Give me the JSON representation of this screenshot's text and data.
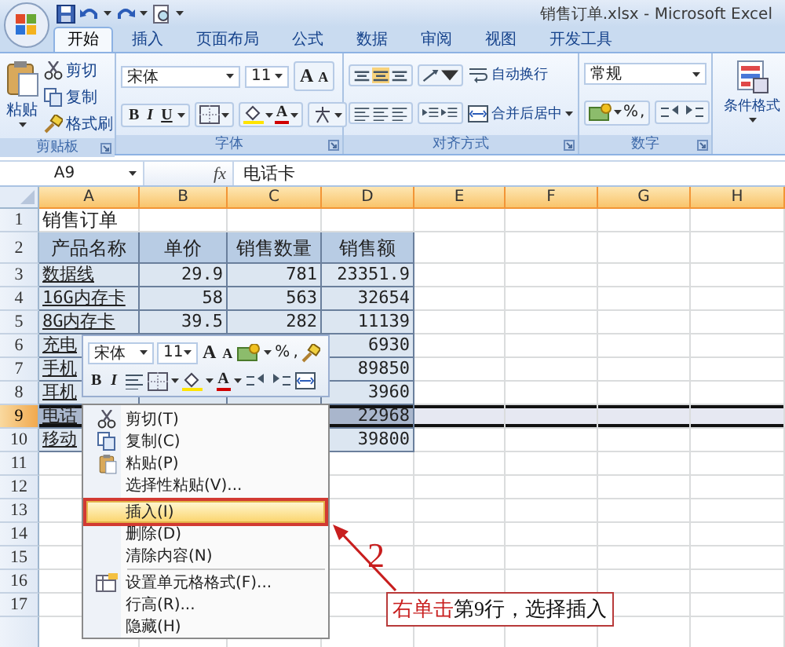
{
  "window": {
    "title": "销售订单.xlsx - Microsoft Excel"
  },
  "tabs": [
    {
      "label": "开始",
      "selected": true
    },
    {
      "label": "插入",
      "selected": false
    },
    {
      "label": "页面布局",
      "selected": false
    },
    {
      "label": "公式",
      "selected": false
    },
    {
      "label": "数据",
      "selected": false
    },
    {
      "label": "审阅",
      "selected": false
    },
    {
      "label": "视图",
      "selected": false
    },
    {
      "label": "开发工具",
      "selected": false
    }
  ],
  "ribbon": {
    "clipboard": {
      "label": "剪贴板",
      "paste": "粘贴",
      "cut": "剪切",
      "copy": "复制",
      "painter": "格式刷"
    },
    "font": {
      "label": "字体",
      "face": "宋体",
      "size": "11",
      "grow": "A",
      "shrink": "A",
      "bold": "B",
      "italic": "I",
      "underline": "U",
      "color_button": "A"
    },
    "alignment": {
      "label": "对齐方式",
      "wrap": "自动换行",
      "merge": "合并后居中"
    },
    "number": {
      "label": "数字",
      "format": "常规",
      "percent": "%",
      "comma": ","
    },
    "styles": {
      "conditional": "条件格式"
    }
  },
  "formula_bar": {
    "name_box": "A9",
    "function_label": "fx",
    "value": "电话卡"
  },
  "sheet": {
    "columns": [
      "A",
      "B",
      "C",
      "D",
      "E",
      "F",
      "G",
      "H"
    ],
    "rows": [
      {
        "number": "1",
        "selected": false,
        "cells": [
          {
            "kind": "title",
            "text": "销售订单"
          }
        ]
      },
      {
        "number": "2",
        "selected": false,
        "cells": [
          {
            "kind": "header",
            "text": "产品名称"
          },
          {
            "kind": "header",
            "text": "单价"
          },
          {
            "kind": "header",
            "text": "销售数量"
          },
          {
            "kind": "header",
            "text": "销售额"
          }
        ]
      },
      {
        "number": "3",
        "selected": false,
        "cells": [
          {
            "kind": "text",
            "text": "数据线"
          },
          {
            "kind": "number",
            "text": "29.9"
          },
          {
            "kind": "number",
            "text": "781"
          },
          {
            "kind": "number",
            "text": "23351.9"
          }
        ]
      },
      {
        "number": "4",
        "selected": false,
        "cells": [
          {
            "kind": "text",
            "text": "16G内存卡"
          },
          {
            "kind": "number",
            "text": "58"
          },
          {
            "kind": "number",
            "text": "563"
          },
          {
            "kind": "number",
            "text": "32654"
          }
        ]
      },
      {
        "number": "5",
        "selected": false,
        "cells": [
          {
            "kind": "text",
            "text": "8G内存卡"
          },
          {
            "kind": "number",
            "text": "39.5"
          },
          {
            "kind": "number",
            "text": "282"
          },
          {
            "kind": "number",
            "text": "11139"
          }
        ]
      },
      {
        "number": "6",
        "selected": false,
        "cells": [
          {
            "kind": "text",
            "text": "充电"
          },
          {
            "kind": "covered"
          },
          {
            "kind": "covered"
          },
          {
            "kind": "number",
            "text": "6930"
          }
        ]
      },
      {
        "number": "7",
        "selected": false,
        "cells": [
          {
            "kind": "text",
            "text": "手机"
          },
          {
            "kind": "covered"
          },
          {
            "kind": "covered"
          },
          {
            "kind": "number",
            "text": "89850"
          }
        ]
      },
      {
        "number": "8",
        "selected": false,
        "cells": [
          {
            "kind": "text",
            "text": "耳机"
          },
          {
            "kind": "number"
          },
          {
            "kind": "number"
          },
          {
            "kind": "number",
            "text": "3960"
          }
        ]
      },
      {
        "number": "9",
        "selected": true,
        "cells": [
          {
            "kind": "text",
            "text": "电话"
          },
          {
            "kind": "number"
          },
          {
            "kind": "number"
          },
          {
            "kind": "number",
            "text": "22968"
          }
        ]
      },
      {
        "number": "10",
        "selected": false,
        "cells": [
          {
            "kind": "text",
            "text": "移动"
          },
          {
            "kind": "number"
          },
          {
            "kind": "number"
          },
          {
            "kind": "number",
            "text": "39800"
          }
        ]
      },
      {
        "number": "11",
        "selected": false,
        "cells": []
      },
      {
        "number": "12",
        "selected": false,
        "cells": []
      },
      {
        "number": "13",
        "selected": false,
        "cells": []
      },
      {
        "number": "14",
        "selected": false,
        "cells": []
      },
      {
        "number": "15",
        "selected": false,
        "cells": []
      },
      {
        "number": "16",
        "selected": false,
        "cells": []
      },
      {
        "number": "17",
        "selected": false,
        "cells": []
      }
    ]
  },
  "mini_toolbar": {
    "face": "宋体",
    "size": "11",
    "grow": "A",
    "shrink": "A",
    "percent": "%",
    "comma": ",",
    "bold": "B",
    "italic": "I",
    "color_button": "A"
  },
  "context_menu": {
    "items": [
      {
        "kind": "cut",
        "label": "剪切(T)",
        "selected": false,
        "marked": false
      },
      {
        "kind": "copy",
        "label": "复制(C)",
        "selected": false,
        "marked": false
      },
      {
        "kind": "paste",
        "label": "粘贴(P)",
        "selected": false,
        "marked": false
      },
      {
        "kind": "text",
        "label": "选择性粘贴(V)...",
        "selected": false,
        "marked": false
      },
      {
        "kind": "separator"
      },
      {
        "kind": "text",
        "label": "插入(I)",
        "selected": true,
        "marked": true
      },
      {
        "kind": "text",
        "label": "删除(D)",
        "selected": false,
        "marked": false
      },
      {
        "kind": "text",
        "label": "清除内容(N)",
        "selected": false,
        "marked": false
      },
      {
        "kind": "separator"
      },
      {
        "kind": "format",
        "label": "设置单元格格式(F)...",
        "selected": false,
        "marked": false
      },
      {
        "kind": "text",
        "label": "行高(R)...",
        "selected": false,
        "marked": false
      },
      {
        "kind": "text",
        "label": "隐藏(H)",
        "selected": false,
        "marked": false
      }
    ]
  },
  "callout": {
    "number": "2",
    "parts": [
      {
        "text": "右单击",
        "emphasis": true
      },
      {
        "text": "第9行，选择插入",
        "emphasis": false
      }
    ]
  }
}
